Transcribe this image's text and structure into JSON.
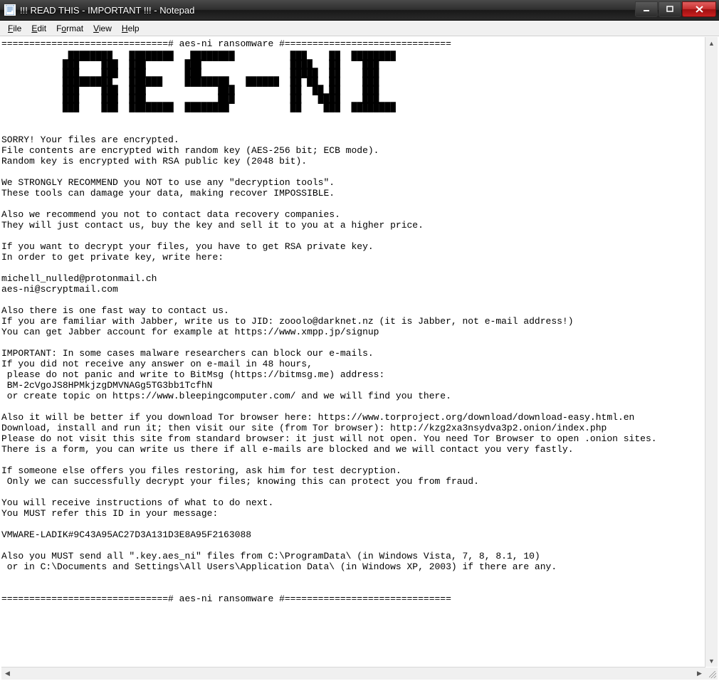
{
  "window": {
    "title": "!!! READ THIS - IMPORTANT !!! - Notepad",
    "app_icon_name": "notepad-icon"
  },
  "menubar": {
    "items": [
      {
        "label": "File",
        "accel_index": 0
      },
      {
        "label": "Edit",
        "accel_index": 0
      },
      {
        "label": "Format",
        "accel_index": 1
      },
      {
        "label": "View",
        "accel_index": 0
      },
      {
        "label": "Help",
        "accel_index": 0
      }
    ]
  },
  "document": {
    "header_rule": "==============================# aes-ni ransomware #==============================",
    "ascii_art": "            ████████   ████████   ████████          ███    ██  ████████ \n           ███    ███  ███       ███                ████   ██    ███    \n           ███    ███  ███       ███                █████  ██    ███    \n           █████████   ██████    ████████   ██████  ██ ██  ██    ███    \n           ███    ███  ███             ███          ██  ██ ██    ███    \n           ███    ███  ███             ███          ██   ████    ███    \n           ███    ███  ████████  ████████           ██    ███  ████████ ",
    "blank1": "",
    "line_sorry": "SORRY! Your files are encrypted.",
    "line_filecontents": "File contents are encrypted with random key (AES-256 bit; ECB mode).",
    "line_randomkey": "Random key is encrypted with RSA public key (2048 bit).",
    "blank2": "",
    "line_strong1": "We STRONGLY RECOMMEND you NOT to use any \"decryption tools\".",
    "line_strong2": "These tools can damage your data, making recover IMPOSSIBLE.",
    "blank3": "",
    "line_rec1": "Also we recommend you not to contact data recovery companies.",
    "line_rec2": "They will just contact us, buy the key and sell it to you at a higher price.",
    "blank4": "",
    "line_decrypt1": "If you want to decrypt your files, you have to get RSA private key.",
    "line_decrypt2": "In order to get private key, write here:",
    "blank5": "",
    "email1": "michell_nulled@protonmail.ch",
    "email2": "aes-ni@scryptmail.com",
    "blank6": "",
    "line_fast1": "Also there is one fast way to contact us.",
    "line_fast2": "If you are familiar with Jabber, write us to JID: zooolo@darknet.nz (it is Jabber, not e-mail address!)",
    "line_fast3": "You can get Jabber account for example at https://www.xmpp.jp/signup",
    "blank7": "",
    "line_imp1": "IMPORTANT: In some cases malware researchers can block our e-mails.",
    "line_imp2": "If you did not receive any answer on e-mail in 48 hours,",
    "line_imp3": " please do not panic and write to BitMsg (https://bitmsg.me) address:",
    "line_imp4": " BM-2cVgoJS8HPMkjzgDMVNAGg5TG3bb1TcfhN",
    "line_imp5": " or create topic on https://www.bleepingcomputer.com/ and we will find you there.",
    "blank8": "",
    "line_tor1": "Also it will be better if you download Tor browser here: https://www.torproject.org/download/download-easy.html.en",
    "line_tor2": "Download, install and run it; then visit our site (from Tor browser): http://kzg2xa3nsydva3p2.onion/index.php",
    "line_tor3": "Please do not visit this site from standard browser: it just will not open. You need Tor Browser to open .onion sites.",
    "line_tor4": "There is a form, you can write us there if all e-mails are blocked and we will contact you very fastly.",
    "blank9": "",
    "line_test1": "If someone else offers you files restoring, ask him for test decryption.",
    "line_test2": " Only we can successfully decrypt your files; knowing this can protect you from fraud.",
    "blank10": "",
    "line_instr1": "You will receive instructions of what to do next.",
    "line_instr2": "You MUST refer this ID in your message:",
    "blank11": "",
    "id_line": "VMWARE-LADIK#9C43A95AC27D3A131D3E8A95F2163088",
    "blank12": "",
    "line_keys1": "Also you MUST send all \".key.aes_ni\" files from C:\\ProgramData\\ (in Windows Vista, 7, 8, 8.1, 10)",
    "line_keys2": " or in C:\\Documents and Settings\\All Users\\Application Data\\ (in Windows XP, 2003) if there are any.",
    "blank13": "",
    "blank14": "",
    "footer_rule": "==============================# aes-ni ransomware #=============================="
  }
}
